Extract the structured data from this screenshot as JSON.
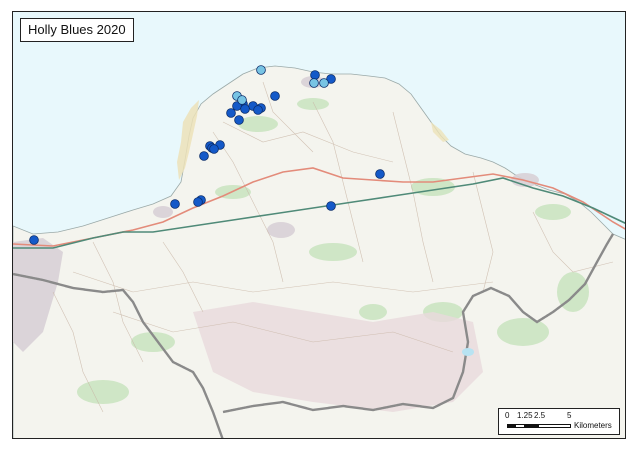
{
  "map": {
    "title": "Holly Blues 2020",
    "colors": {
      "sea": "#e8f8fc",
      "land": "#f4f4ee",
      "road": "#e38b7a",
      "rail": "#4f8a78",
      "boundary": "#8a8a8a",
      "green": "#cfe6c6",
      "sand": "#ece2b8",
      "urban": "#d8d0d6",
      "hill": "#e9d9dc"
    },
    "scale_bar": {
      "ticks": [
        "0",
        "1.25",
        "2.5",
        "5"
      ],
      "unit": "Kilometers"
    },
    "legend_colors": {
      "dark_blue": "#1459c8",
      "light_blue": "#78c4e4"
    }
  },
  "records": [
    {
      "id": "r1",
      "shade": "light_blue"
    },
    {
      "id": "r2",
      "shade": "dark_blue"
    },
    {
      "id": "r3",
      "shade": "dark_blue"
    },
    {
      "id": "r4",
      "shade": "light_blue"
    },
    {
      "id": "r5",
      "shade": "light_blue"
    },
    {
      "id": "r6",
      "shade": "light_blue"
    },
    {
      "id": "r7",
      "shade": "dark_blue"
    },
    {
      "id": "r8",
      "shade": "dark_blue"
    },
    {
      "id": "r9",
      "shade": "dark_blue"
    },
    {
      "id": "r10",
      "shade": "dark_blue"
    },
    {
      "id": "r11",
      "shade": "dark_blue"
    },
    {
      "id": "r12",
      "shade": "dark_blue"
    },
    {
      "id": "r13",
      "shade": "dark_blue"
    },
    {
      "id": "r14",
      "shade": "dark_blue"
    },
    {
      "id": "r15",
      "shade": "dark_blue"
    },
    {
      "id": "r16",
      "shade": "dark_blue"
    },
    {
      "id": "r17",
      "shade": "dark_blue"
    },
    {
      "id": "r18",
      "shade": "dark_blue"
    },
    {
      "id": "r19",
      "shade": "dark_blue"
    },
    {
      "id": "r20",
      "shade": "dark_blue"
    },
    {
      "id": "r21",
      "shade": "dark_blue"
    },
    {
      "id": "r22",
      "shade": "dark_blue"
    },
    {
      "id": "r23",
      "shade": "dark_blue"
    },
    {
      "id": "r24",
      "shade": "dark_blue"
    },
    {
      "id": "r25",
      "shade": "dark_blue"
    },
    {
      "id": "r26",
      "shade": "dark_blue"
    },
    {
      "id": "r27",
      "shade": "light_blue"
    }
  ]
}
